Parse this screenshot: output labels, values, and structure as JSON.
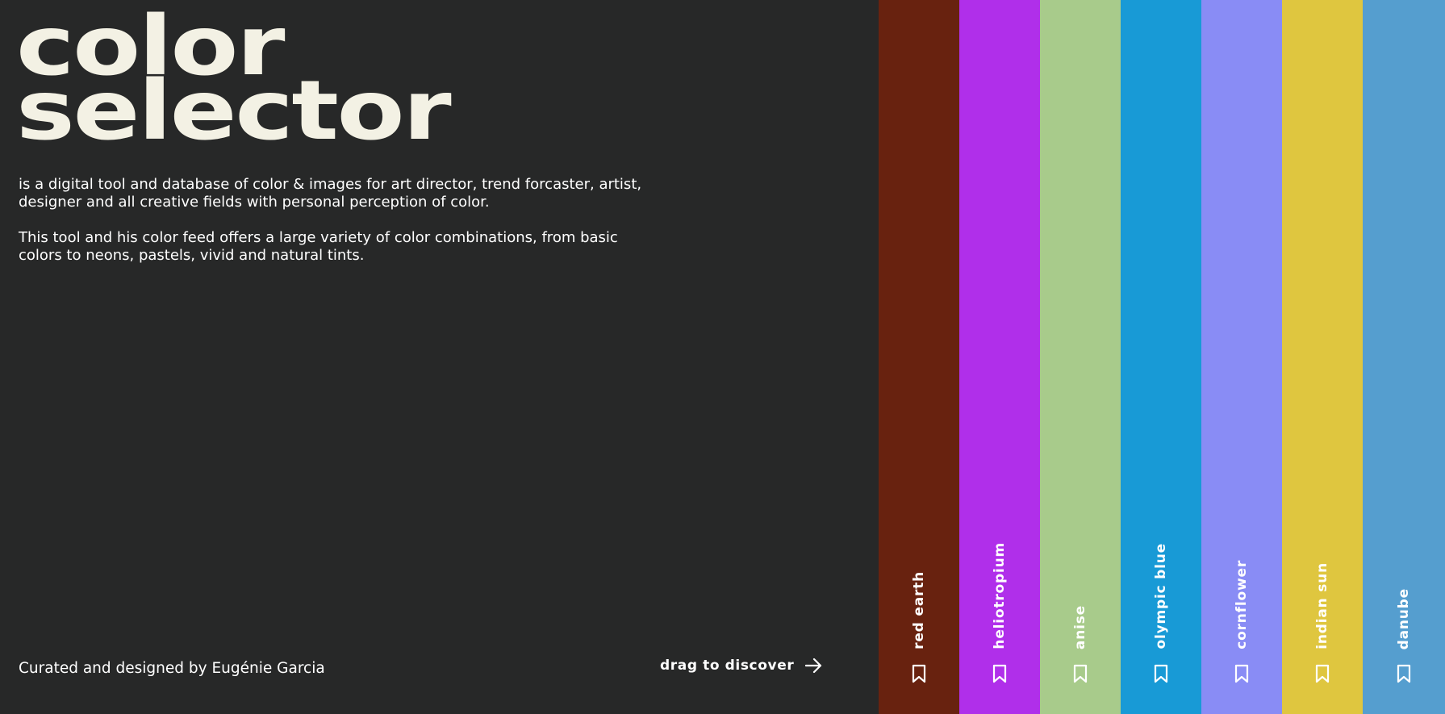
{
  "hero": {
    "title_line1": "color",
    "title_line2": "selector",
    "description_p1": "is a digital tool and database of color & images for art director, trend forcaster, artist, designer and all creative fields with personal perception of color.",
    "description_p2": "This tool and his color feed offers a large variety of color combinations, from basic colors to neons, pastels, vivid and natural tints."
  },
  "footer": {
    "credit": "Curated and designed by Eugénie Garcia",
    "discover_label": "drag to discover",
    "discover_icon": "arrow-right-icon"
  },
  "colors": {
    "background": "#272828",
    "text": "#f3f1e4"
  },
  "swatches": [
    {
      "name": "red earth",
      "color": "#68220f",
      "icon": "bookmark-icon"
    },
    {
      "name": "heliotropium",
      "color": "#b02fea",
      "icon": "bookmark-icon"
    },
    {
      "name": "anise",
      "color": "#a8cb8b",
      "icon": "bookmark-icon"
    },
    {
      "name": "olympic blue",
      "color": "#189ad6",
      "icon": "bookmark-icon"
    },
    {
      "name": "cornflower",
      "color": "#898cf5",
      "icon": "bookmark-icon"
    },
    {
      "name": "indian sun",
      "color": "#dfc63f",
      "icon": "bookmark-icon"
    },
    {
      "name": "danube",
      "color": "#559ecf",
      "icon": "bookmark-icon"
    }
  ]
}
